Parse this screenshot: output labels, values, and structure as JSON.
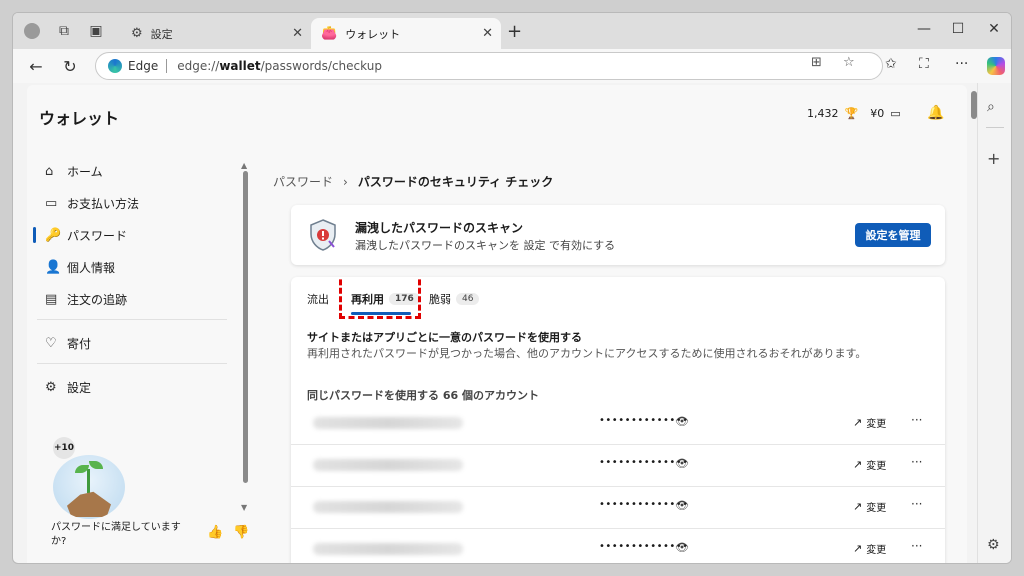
{
  "browser": {
    "tabs": [
      {
        "label": "設定"
      },
      {
        "label": "ウォレット"
      }
    ],
    "address": {
      "brand": "Edge",
      "url_prefix": "edge://",
      "url_host": "wallet",
      "url_path": "/passwords/checkup"
    }
  },
  "header": {
    "title": "ウォレット",
    "points": "1,432",
    "balance": "¥0"
  },
  "sidebar": {
    "items": [
      {
        "label": "ホーム"
      },
      {
        "label": "お支払い方法"
      },
      {
        "label": "パスワード"
      },
      {
        "label": "個人情報"
      },
      {
        "label": "注文の追跡"
      },
      {
        "label": "寄付"
      },
      {
        "label": "設定"
      }
    ],
    "badge": "+10",
    "survey": "パスワードに満足していますか?"
  },
  "breadcrumb": {
    "parent": "パスワード",
    "current": "パスワードのセキュリティ チェック"
  },
  "scan": {
    "title": "漏洩したパスワードのスキャン",
    "desc": "漏洩したパスワードのスキャンを 設定 で有効にする",
    "button": "設定を管理"
  },
  "tabs": {
    "leaked": {
      "label": "流出"
    },
    "reused": {
      "label": "再利用",
      "count": "176"
    },
    "weak": {
      "label": "脆弱",
      "count": "46"
    }
  },
  "reuse": {
    "title": "サイトまたはアプリごとに一意のパスワードを使用する",
    "desc": "再利用されたパスワードが見つかった場合、他のアカウントにアクセスするために使用されるおそれがあります。",
    "heading": "同じパスワードを使用する 66 個のアカウント"
  },
  "accounts": [
    {
      "password": "••••••••••••••",
      "change": "変更"
    },
    {
      "password": "••••••••••••••",
      "change": "変更"
    },
    {
      "password": "••••••••••••••",
      "change": "変更"
    },
    {
      "password": "••••••••••••••",
      "change": "変更"
    }
  ],
  "colors": {
    "accent": "#0f5cb8",
    "highlight": "#e00000"
  }
}
